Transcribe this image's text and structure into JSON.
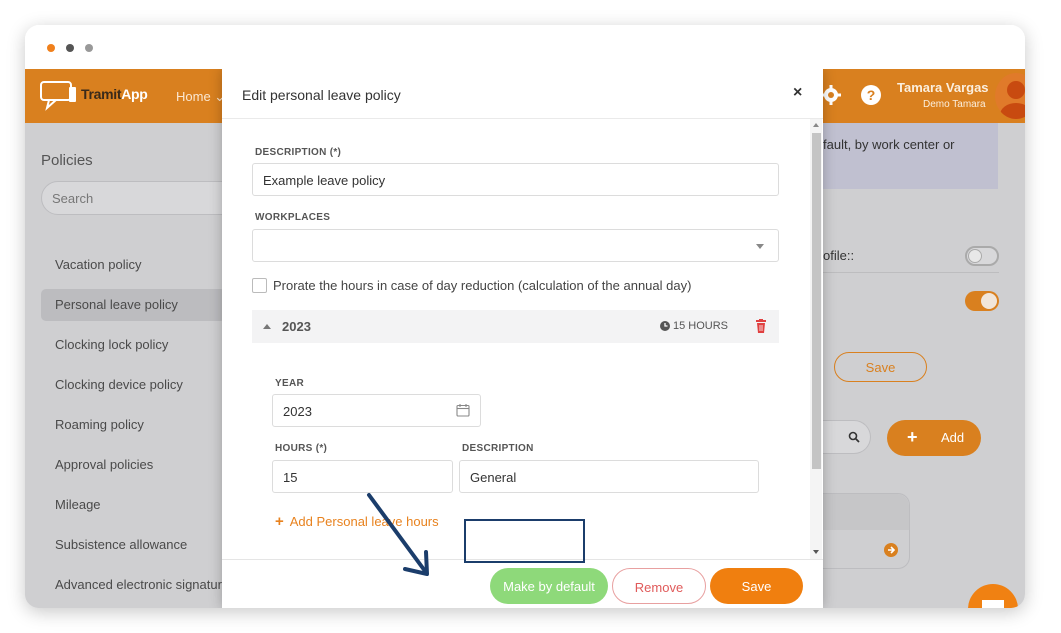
{
  "colors": {
    "brand": "#e8821e",
    "topbar": "#d9801f",
    "make_default": "#8ed97a",
    "highlight_box": "#1b3d6b",
    "danger": "#e05a5a"
  },
  "app": {
    "logo_text_1": "Tramit",
    "logo_text_2": "App",
    "nav_home": "Home",
    "user_name": "Tamara Vargas",
    "user_company": "Demo Tamara",
    "icons": [
      "gear-icon",
      "help-icon"
    ]
  },
  "sidebar": {
    "title": "Policies",
    "search_placeholder": "Search",
    "items": [
      {
        "label": "Vacation policy",
        "active": false
      },
      {
        "label": "Personal leave policy",
        "active": true
      },
      {
        "label": "Clocking lock policy",
        "active": false
      },
      {
        "label": "Clocking device policy",
        "active": false
      },
      {
        "label": "Roaming policy",
        "active": false
      },
      {
        "label": "Approval policies",
        "active": false
      },
      {
        "label": "Mileage",
        "active": false
      },
      {
        "label": "Subsistence allowance",
        "active": false
      },
      {
        "label": "Advanced electronic signature",
        "active": false
      }
    ]
  },
  "background_right": {
    "info_text": "fault, by work center or",
    "profile_label": "ofile::",
    "save_label": "Save",
    "add_label": "Add"
  },
  "modal": {
    "title": "Edit personal leave policy",
    "close_glyph": "×",
    "description_label": "DESCRIPTION (*)",
    "description_value": "Example leave policy",
    "workplaces_label": "WORKPLACES",
    "workplaces_value": "",
    "prorate_label": "Prorate the hours in case of day reduction (calculation of the annual day)",
    "prorate_checked": false,
    "year_block": {
      "year": "2023",
      "hours_summary": "15 HOURS",
      "year_label": "YEAR",
      "year_value": "2023",
      "hours_label": "HOURS (*)",
      "hours_value": "15",
      "desc_label": "DESCRIPTION",
      "desc_value": "General"
    },
    "add_hours_link": "Add Personal leave hours",
    "footer": {
      "make_default_label": "Make by default",
      "remove_label": "Remove",
      "save_label": "Save"
    }
  }
}
